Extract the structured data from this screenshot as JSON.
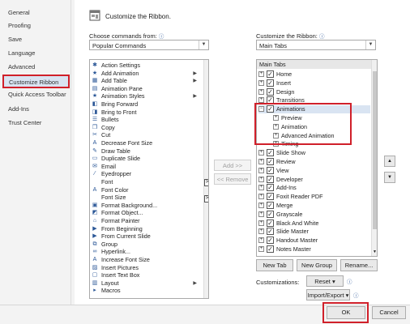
{
  "sidebar": {
    "items": [
      "General",
      "Proofing",
      "Save",
      "Language",
      "Advanced",
      "Customize Ribbon",
      "Quick Access Toolbar",
      "Add-Ins",
      "Trust Center"
    ],
    "selected": "Customize Ribbon"
  },
  "header": {
    "title": "Customize the Ribbon."
  },
  "commands": {
    "label": "Choose commands from:",
    "info_icon": "info-icon",
    "selected": "Popular Commands",
    "items": [
      {
        "label": "Action Settings",
        "icon": "action-icon",
        "arrow": false
      },
      {
        "label": "Add Animation",
        "icon": "star-icon",
        "arrow": true
      },
      {
        "label": "Add Table",
        "icon": "table-icon",
        "arrow": true
      },
      {
        "label": "Animation Pane",
        "icon": "pane-icon",
        "arrow": false
      },
      {
        "label": "Animation Styles",
        "icon": "star-icon",
        "arrow": true
      },
      {
        "label": "Bring Forward",
        "icon": "forward-icon",
        "arrow": false
      },
      {
        "label": "Bring to Front",
        "icon": "front-icon",
        "arrow": false
      },
      {
        "label": "Bullets",
        "icon": "bullets-icon",
        "arrow": false
      },
      {
        "label": "Copy",
        "icon": "copy-icon",
        "arrow": false
      },
      {
        "label": "Cut",
        "icon": "scissors-icon",
        "arrow": false
      },
      {
        "label": "Decrease Font Size",
        "icon": "font-icon",
        "arrow": false
      },
      {
        "label": "Draw Table",
        "icon": "pencil-icon",
        "arrow": false
      },
      {
        "label": "Duplicate Slide",
        "icon": "slide-icon",
        "arrow": false
      },
      {
        "label": "Email",
        "icon": "mail-icon",
        "arrow": false
      },
      {
        "label": "Eyedropper",
        "icon": "eyedropper-icon",
        "arrow": false
      },
      {
        "label": "Font",
        "icon": "blank-icon",
        "arrow": false
      },
      {
        "label": "Font Color",
        "icon": "font-color-icon",
        "arrow": false
      },
      {
        "label": "Font Size",
        "icon": "blank-icon",
        "arrow": false
      },
      {
        "label": "Format Background...",
        "icon": "background-icon",
        "arrow": false
      },
      {
        "label": "Format Object...",
        "icon": "object-icon",
        "arrow": false
      },
      {
        "label": "Format Painter",
        "icon": "brush-icon",
        "arrow": false
      },
      {
        "label": "From Beginning",
        "icon": "play-icon",
        "arrow": false
      },
      {
        "label": "From Current Slide",
        "icon": "play-icon",
        "arrow": false
      },
      {
        "label": "Group",
        "icon": "group-icon",
        "arrow": false
      },
      {
        "label": "Hyperlink...",
        "icon": "link-icon",
        "arrow": false
      },
      {
        "label": "Increase Font Size",
        "icon": "font-icon",
        "arrow": false
      },
      {
        "label": "Insert Pictures",
        "icon": "picture-icon",
        "arrow": false
      },
      {
        "label": "Insert Text Box",
        "icon": "textbox-icon",
        "arrow": false
      },
      {
        "label": "Layout",
        "icon": "layout-icon",
        "arrow": true
      },
      {
        "label": "Macros",
        "icon": "macro-icon",
        "arrow": false
      }
    ]
  },
  "middle": {
    "add_label": "Add >>",
    "remove_label": "<< Remove"
  },
  "ribbon": {
    "label": "Customize the Ribbon:",
    "selected": "Main Tabs",
    "header": "Main Tabs",
    "nodes": [
      {
        "label": "Home",
        "level": 0,
        "exp": "+",
        "chk": true
      },
      {
        "label": "Insert",
        "level": 0,
        "exp": "+",
        "chk": true
      },
      {
        "label": "Design",
        "level": 0,
        "exp": "+",
        "chk": true
      },
      {
        "label": "Transitions",
        "level": 0,
        "exp": "+",
        "chk": true
      },
      {
        "label": "Animations",
        "level": 0,
        "exp": "−",
        "chk": true,
        "sel": true
      },
      {
        "label": "Preview",
        "level": 1,
        "exp": "+",
        "chk": false
      },
      {
        "label": "Animation",
        "level": 1,
        "exp": "+",
        "chk": false
      },
      {
        "label": "Advanced Animation",
        "level": 1,
        "exp": "+",
        "chk": false
      },
      {
        "label": "Timing",
        "level": 1,
        "exp": "+",
        "chk": false
      },
      {
        "label": "Slide Show",
        "level": 0,
        "exp": "+",
        "chk": true
      },
      {
        "label": "Review",
        "level": 0,
        "exp": "+",
        "chk": true
      },
      {
        "label": "View",
        "level": 0,
        "exp": "+",
        "chk": true
      },
      {
        "label": "Developer",
        "level": 0,
        "exp": "+",
        "chk": true
      },
      {
        "label": "Add-Ins",
        "level": 0,
        "exp": "+",
        "chk": true
      },
      {
        "label": "Foxit Reader PDF",
        "level": 0,
        "exp": "+",
        "chk": true
      },
      {
        "label": "Merge",
        "level": 0,
        "exp": "+",
        "chk": true
      },
      {
        "label": "Grayscale",
        "level": 0,
        "exp": "+",
        "chk": true
      },
      {
        "label": "Black And White",
        "level": 0,
        "exp": "+",
        "chk": true
      },
      {
        "label": "Slide Master",
        "level": 0,
        "exp": "+",
        "chk": true
      },
      {
        "label": "Handout Master",
        "level": 0,
        "exp": "+",
        "chk": true
      },
      {
        "label": "Notes Master",
        "level": 0,
        "exp": "+",
        "chk": true
      }
    ],
    "new_tab": "New Tab",
    "new_group": "New Group",
    "rename": "Rename...",
    "customizations_label": "Customizations:",
    "reset": "Reset ▾",
    "import_export": "Import/Export ▾"
  },
  "footer": {
    "ok": "OK",
    "cancel": "Cancel"
  },
  "colors": {
    "highlight": "#d0202a",
    "selection": "#d9e4f2",
    "accent": "#2b5797"
  }
}
